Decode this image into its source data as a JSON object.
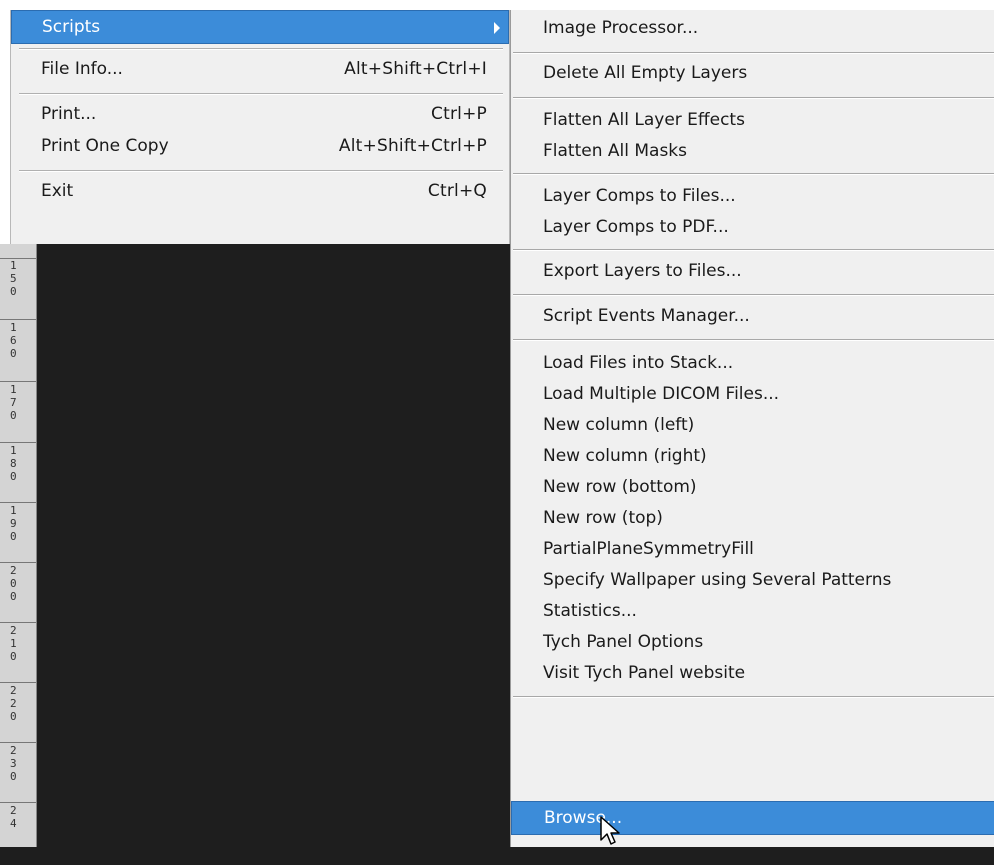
{
  "main_menu": {
    "items": [
      {
        "label": "Scripts",
        "shortcut": ""
      },
      {
        "label": "File Info...",
        "shortcut": "Alt+Shift+Ctrl+I"
      },
      {
        "label": "Print...",
        "shortcut": "Ctrl+P"
      },
      {
        "label": "Print One Copy",
        "shortcut": "Alt+Shift+Ctrl+P"
      },
      {
        "label": "Exit",
        "shortcut": "Ctrl+Q"
      }
    ]
  },
  "submenu": {
    "items": [
      {
        "label": "Image Processor..."
      },
      {
        "label": "Delete All Empty Layers"
      },
      {
        "label": "Flatten All Layer Effects"
      },
      {
        "label": "Flatten All Masks"
      },
      {
        "label": "Layer Comps to Files..."
      },
      {
        "label": "Layer Comps to PDF..."
      },
      {
        "label": "Export Layers to Files..."
      },
      {
        "label": "Script Events Manager..."
      },
      {
        "label": "Load Files into Stack..."
      },
      {
        "label": "Load Multiple DICOM Files..."
      },
      {
        "label": "New column (left)"
      },
      {
        "label": "New column (right)"
      },
      {
        "label": "New row (bottom)"
      },
      {
        "label": "New row (top)"
      },
      {
        "label": "PartialPlaneSymmetryFill"
      },
      {
        "label": "Specify Wallpaper using Several Patterns"
      },
      {
        "label": "Statistics..."
      },
      {
        "label": "Tych Panel Options"
      },
      {
        "label": "Visit Tych Panel website"
      },
      {
        "label": "Browse..."
      }
    ]
  },
  "ruler": {
    "labels": [
      "150",
      "160",
      "170",
      "180",
      "190",
      "200",
      "210",
      "220",
      "230",
      "24"
    ]
  },
  "colors": {
    "highlight": "#3c8cd9",
    "menu_bg": "#f0f0f0",
    "canvas_bg": "#1e1e1e"
  }
}
